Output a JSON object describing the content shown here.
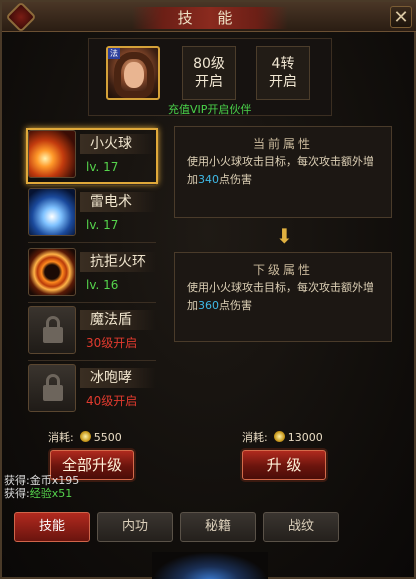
{
  "window": {
    "title": "技 能",
    "close_symbol": "✕"
  },
  "top": {
    "portrait_badge": "法",
    "level_req": "80级\n开启",
    "level_req_line1": "80级",
    "level_req_line2": "开启",
    "turn_req_line1": "4转",
    "turn_req_line2": "开启",
    "vip_link": "充值VIP开启伙伴"
  },
  "skills": [
    {
      "name": "小火球",
      "sub": "lv. 17",
      "status": "level",
      "icon": "fireball-icon",
      "selected": true
    },
    {
      "name": "雷电术",
      "sub": "lv. 17",
      "status": "level",
      "icon": "lightning-icon",
      "selected": false
    },
    {
      "name": "抗拒火环",
      "sub": "lv. 16",
      "status": "level",
      "icon": "fire-ring-icon",
      "selected": false
    },
    {
      "name": "魔法盾",
      "sub": "30级开启",
      "status": "locked",
      "icon": "lock-icon",
      "selected": false
    },
    {
      "name": "冰咆哮",
      "sub": "40级开启",
      "status": "locked",
      "icon": "lock-icon",
      "selected": false
    }
  ],
  "current_attr": {
    "heading": "当前属性",
    "desc_before": "使用小火球攻击目标，每次攻击额外增加",
    "value": "340",
    "desc_after": "点伤害"
  },
  "next_attr": {
    "heading": "下级属性",
    "desc_before": "使用小火球攻击目标，每次攻击额外增加",
    "value": "360",
    "desc_after": "点伤害"
  },
  "cost_all": {
    "label": "消耗:",
    "amount": "5500"
  },
  "cost_one": {
    "label": "消耗:",
    "amount": "13000"
  },
  "buttons": {
    "upgrade_all": "全部升级",
    "upgrade": "升 级"
  },
  "gains": {
    "line1_prefix": "获得:",
    "line1_value": "金币x195",
    "line2_prefix": "获得:",
    "line2_value": "经验x51"
  },
  "tabs": [
    {
      "label": "技能",
      "active": true
    },
    {
      "label": "内功",
      "active": false
    },
    {
      "label": "秘籍",
      "active": false
    },
    {
      "label": "战纹",
      "active": false
    }
  ],
  "colors": {
    "accent_red": "#8a2a1e",
    "level_green": "#55d44c",
    "locked_red": "#e03a2e",
    "value_blue": "#3fb9e6",
    "gold_frame": "#e0a93a"
  }
}
